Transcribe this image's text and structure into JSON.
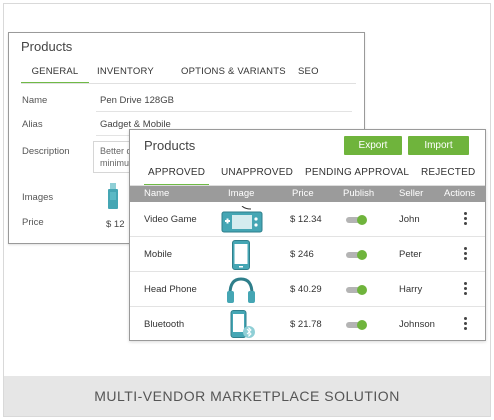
{
  "back_panel": {
    "title": "Products",
    "tabs": [
      "GENERAL",
      "INVENTORY",
      "OPTIONS & VARIANTS",
      "SEO"
    ],
    "fields": {
      "name_label": "Name",
      "name_value": "Pen Drive 128GB",
      "alias_label": "Alias",
      "alias_value": "Gadget & Mobile",
      "description_label": "Description",
      "description_text_1": "Better q",
      "description_text_2": "minimu",
      "images_label": "Images",
      "price_label": "Price",
      "price_value": "$ 12"
    }
  },
  "front_panel": {
    "title": "Products",
    "export_label": "Export",
    "import_label": "Import",
    "tabs": [
      "APPROVED",
      "UNAPPROVED",
      "PENDING APPROVAL",
      "REJECTED"
    ],
    "columns": [
      "Name",
      "Image",
      "Price",
      "Publish",
      "Seller",
      "Actions"
    ],
    "rows": [
      {
        "name": "Video Game",
        "image_icon": "gamepad-icon",
        "price": "$ 12.34",
        "publish": true,
        "seller": "John"
      },
      {
        "name": "Mobile",
        "image_icon": "smartphone-icon",
        "price": "$ 246",
        "publish": true,
        "seller": "Peter"
      },
      {
        "name": "Head Phone",
        "image_icon": "headphones-icon",
        "price": "$ 40.29",
        "publish": true,
        "seller": "Harry"
      },
      {
        "name": "Bluetooth",
        "image_icon": "bluetooth-phone-icon",
        "price": "$ 21.78",
        "publish": true,
        "seller": "Johnson"
      }
    ]
  },
  "colors": {
    "accent": "#6fb43c",
    "icon_blue": "#45a6b4",
    "header_gray": "#9b9b9b",
    "footer_bg": "#e6e6e6"
  },
  "footer": {
    "caption": "MULTI-VENDOR MARKETPLACE SOLUTION"
  }
}
